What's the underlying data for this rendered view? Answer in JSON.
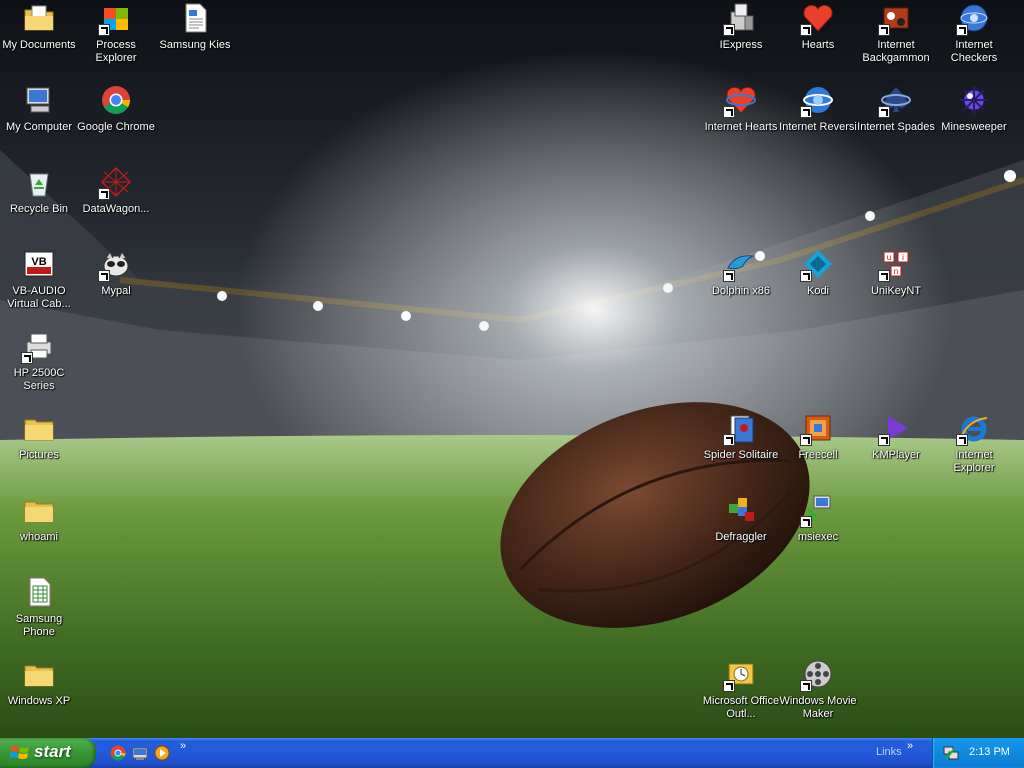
{
  "desktop": {
    "icons": [
      {
        "key": "my-documents",
        "label": "My Documents",
        "icon": "my-documents-folder-icon",
        "shortcut": false
      },
      {
        "key": "process-explorer",
        "label": "Process Explorer",
        "icon": "process-explorer-icon",
        "shortcut": true
      },
      {
        "key": "samsung-kies",
        "label": "Samsung Kies",
        "icon": "document-icon",
        "shortcut": false
      },
      {
        "key": "iexpress",
        "label": "IExpress",
        "icon": "iexpress-icon",
        "shortcut": true
      },
      {
        "key": "hearts",
        "label": "Hearts",
        "icon": "hearts-icon",
        "shortcut": true
      },
      {
        "key": "internet-backgammon",
        "label": "Internet Backgammon",
        "icon": "backgammon-icon",
        "shortcut": true
      },
      {
        "key": "internet-checkers",
        "label": "Internet Checkers",
        "icon": "checkers-icon",
        "shortcut": true
      },
      {
        "key": "my-computer",
        "label": "My Computer",
        "icon": "my-computer-icon",
        "shortcut": false
      },
      {
        "key": "google-chrome",
        "label": "Google Chrome",
        "icon": "chrome-icon",
        "shortcut": false
      },
      {
        "key": "internet-hearts",
        "label": "Internet Hearts",
        "icon": "internet-hearts-icon",
        "shortcut": true
      },
      {
        "key": "internet-reversi",
        "label": "Internet Reversi",
        "icon": "reversi-icon",
        "shortcut": true
      },
      {
        "key": "internet-spades",
        "label": "Internet Spades",
        "icon": "spades-icon",
        "shortcut": true
      },
      {
        "key": "minesweeper",
        "label": "Minesweeper",
        "icon": "minesweeper-icon",
        "shortcut": false
      },
      {
        "key": "recycle-bin",
        "label": "Recycle Bin",
        "icon": "recycle-bin-icon",
        "shortcut": false
      },
      {
        "key": "datawagon",
        "label": "DataWagon...",
        "icon": "datawagon-icon",
        "shortcut": true
      },
      {
        "key": "vb-audio",
        "label": "VB-AUDIO Virtual Cab...",
        "icon": "vb-audio-icon",
        "shortcut": false
      },
      {
        "key": "mypal",
        "label": "Mypal",
        "icon": "mypal-icon",
        "shortcut": true
      },
      {
        "key": "dolphin",
        "label": "Dolphin x86",
        "icon": "dolphin-icon",
        "shortcut": true
      },
      {
        "key": "kodi",
        "label": "Kodi",
        "icon": "kodi-icon",
        "shortcut": true
      },
      {
        "key": "unikeynt",
        "label": "UniKeyNT",
        "icon": "unikey-icon",
        "shortcut": true
      },
      {
        "key": "hp-2500c",
        "label": "HP 2500C Series",
        "icon": "printer-icon",
        "shortcut": true
      },
      {
        "key": "pictures",
        "label": "Pictures",
        "icon": "folder-icon",
        "shortcut": false
      },
      {
        "key": "spider-solitaire",
        "label": "Spider Solitaire",
        "icon": "spider-solitaire-icon",
        "shortcut": true
      },
      {
        "key": "freecell",
        "label": "Freecell",
        "icon": "freecell-icon",
        "shortcut": true
      },
      {
        "key": "kmplayer",
        "label": "KMPlayer",
        "icon": "kmplayer-icon",
        "shortcut": true
      },
      {
        "key": "internet-explorer",
        "label": "Internet Explorer",
        "icon": "internet-explorer-icon",
        "shortcut": true
      },
      {
        "key": "whoami",
        "label": "whoami",
        "icon": "folder-icon",
        "shortcut": false
      },
      {
        "key": "defraggler",
        "label": "Defraggler",
        "icon": "defraggler-icon",
        "shortcut": false
      },
      {
        "key": "msiexec",
        "label": "msiexec",
        "icon": "msiexec-icon",
        "shortcut": true
      },
      {
        "key": "samsung-phone",
        "label": "Samsung Phone",
        "icon": "spreadsheet-icon",
        "shortcut": false
      },
      {
        "key": "windows-xp",
        "label": "Windows XP",
        "icon": "folder-icon",
        "shortcut": false
      },
      {
        "key": "office-outlook",
        "label": "Microsoft Office Outl...",
        "icon": "outlook-icon",
        "shortcut": true
      },
      {
        "key": "movie-maker",
        "label": "Windows Movie Maker",
        "icon": "movie-maker-icon",
        "shortcut": true
      }
    ]
  },
  "taskbar": {
    "start_label": "start",
    "quick_launch": [
      {
        "icon": "chrome-icon"
      },
      {
        "icon": "show-desktop-icon"
      },
      {
        "icon": "media-player-icon"
      }
    ],
    "quick_launch_more": "»",
    "links_label": "Links",
    "links_more": "»",
    "clock": "2:13 PM"
  }
}
